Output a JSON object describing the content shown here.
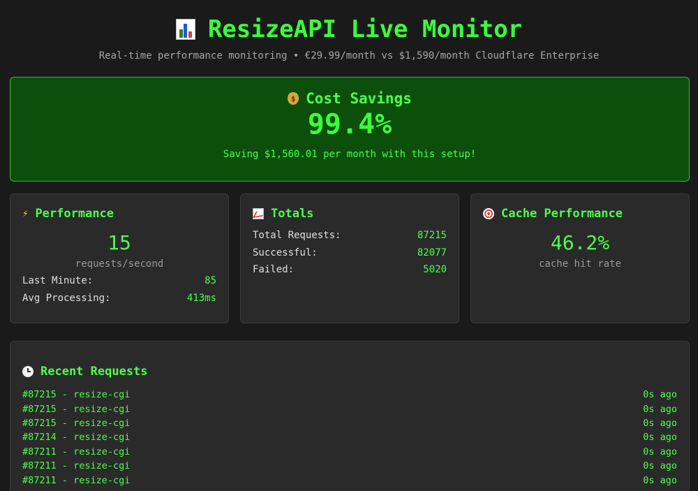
{
  "header": {
    "title": "ResizeAPI Live Monitor",
    "subtitle": "Real-time performance monitoring • €29.99/month vs $1,590/month Cloudflare Enterprise"
  },
  "savings": {
    "title": "Cost Savings",
    "percent": "99.4%",
    "note": "Saving $1,560.01 per month with this setup!"
  },
  "performance": {
    "title": "Performance",
    "value": "15",
    "caption": "requests/second",
    "rows": [
      {
        "label": "Last Minute:",
        "value": "85"
      },
      {
        "label": "Avg Processing:",
        "value": "413ms"
      }
    ]
  },
  "totals": {
    "title": "Totals",
    "rows": [
      {
        "label": "Total Requests:",
        "value": "87215"
      },
      {
        "label": "Successful:",
        "value": "82077"
      },
      {
        "label": "Failed:",
        "value": "5020"
      }
    ]
  },
  "cache": {
    "title": "Cache Performance",
    "value": "46.2%",
    "caption": "cache hit rate"
  },
  "recent": {
    "title": "Recent Requests",
    "items": [
      {
        "label": "#87215 - resize-cgi",
        "time": "0s ago"
      },
      {
        "label": "#87215 - resize-cgi",
        "time": "0s ago"
      },
      {
        "label": "#87215 - resize-cgi",
        "time": "0s ago"
      },
      {
        "label": "#87214 - resize-cgi",
        "time": "0s ago"
      },
      {
        "label": "#87211 - resize-cgi",
        "time": "0s ago"
      },
      {
        "label": "#87211 - resize-cgi",
        "time": "0s ago"
      },
      {
        "label": "#87211 - resize-cgi",
        "time": "0s ago"
      }
    ]
  },
  "colors": {
    "accent": "#3aff3a",
    "background": "#1a1a1a",
    "card": "#2a2a2a",
    "savings_bg": "#0b4f0b"
  },
  "icons": {
    "title": "bar-chart-icon",
    "savings": "money-bag-icon",
    "performance": "lightning-icon",
    "totals": "chart-increasing-icon",
    "cache": "target-icon",
    "recent": "clock-icon"
  }
}
